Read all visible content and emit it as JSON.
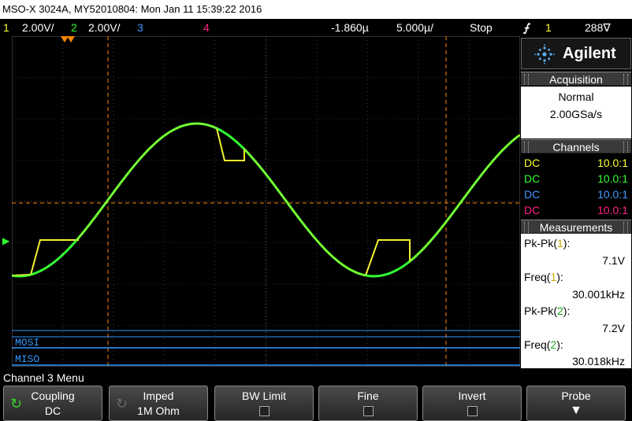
{
  "window": {
    "title": "MSO-X 3024A, MY52010804: Mon Jan 11 15:39:22 2016"
  },
  "status": {
    "ch1_num": "1",
    "ch1_scale": "2.00V/",
    "ch2_num": "2",
    "ch2_scale": "2.00V/",
    "ch3_num": "3",
    "ch4_num": "4",
    "time_delay": "-1.860µ",
    "timebase": "5.000µ/",
    "run_state": "Stop",
    "trigger_icon": "trigger-edge-icon",
    "trigger_source": "1",
    "trigger_level": "288∇"
  },
  "brand": {
    "name": "Agilent"
  },
  "acquisition": {
    "header": "Acquisition",
    "mode": "Normal",
    "rate": "2.00GSa/s"
  },
  "channels": {
    "header": "Channels",
    "rows": [
      {
        "coupling": "DC",
        "ratio": "10.0:1",
        "color": "#ffff33"
      },
      {
        "coupling": "DC",
        "ratio": "10.0:1",
        "color": "#33ff33"
      },
      {
        "coupling": "DC",
        "ratio": "10.0:1",
        "color": "#4499ff"
      },
      {
        "coupling": "DC",
        "ratio": "10.0:1",
        "color": "#ff2288"
      }
    ]
  },
  "measurements": {
    "header": "Measurements",
    "items": [
      {
        "name": "Pk-Pk(",
        "ch": "1",
        "close": "):",
        "value": "7.1V"
      },
      {
        "name": "Freq(",
        "ch": "1",
        "close": "):",
        "value": "30.001kHz"
      },
      {
        "name": "Pk-Pk(",
        "ch": "2",
        "close": "):",
        "value": "7.2V"
      },
      {
        "name": "Freq(",
        "ch": "2",
        "close": "):",
        "value": "30.018kHz"
      }
    ]
  },
  "display": {
    "bus_labels": [
      "MOSI",
      "MISO"
    ],
    "serial_marker": "S",
    "serial_marker_sub": "1",
    "ch2_marker": "2",
    "trigger_marker": "T",
    "colors": {
      "ch1": "#ffff33",
      "ch2": "#33ff33",
      "bus": "#3399ff",
      "cursor": "#ff8800",
      "grid": "#606060"
    }
  },
  "menu": {
    "title": "Channel 3 Menu",
    "softkeys": [
      {
        "label": "Coupling",
        "value": "DC",
        "type": "select"
      },
      {
        "label": "Imped",
        "value": "1M Ohm",
        "type": "select"
      },
      {
        "label": "BW Limit",
        "value": "",
        "type": "check"
      },
      {
        "label": "Fine",
        "value": "",
        "type": "check"
      },
      {
        "label": "Invert",
        "value": "",
        "type": "check"
      },
      {
        "label": "Probe",
        "value": "",
        "type": "submenu"
      }
    ]
  }
}
